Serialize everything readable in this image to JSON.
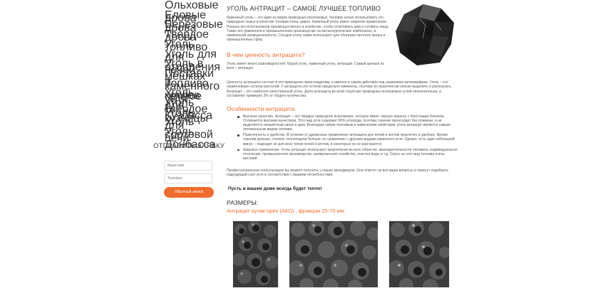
{
  "sidebar": {
    "items": [
      {
        "label": "Ольховые дрова"
      },
      {
        "label": "Еловые дрова"
      },
      {
        "label": "Березовые дрова"
      },
      {
        "label": "Твердое топливо"
      },
      {
        "label": "Уголь для печей и котлов"
      },
      {
        "label": "Уголь для отопления"
      },
      {
        "label": "Уголь в мешках"
      },
      {
        "label": "Поставки каменного угля"
      },
      {
        "label": "Топливо печное твердое"
      },
      {
        "label": "Уголь для кузницы"
      },
      {
        "label": "Уголь Кузбасса"
      },
      {
        "label": "Уголь для печи"
      },
      {
        "label": "Уголь сортовой"
      },
      {
        "label": "Уголь Донбасса"
      }
    ]
  },
  "form": {
    "title_part1": "Отправить",
    "title_part2": "заявку",
    "name_placeholder": "Ваше имя",
    "phone_placeholder": "Телефон",
    "submit_label": "Обратный звонок"
  },
  "article": {
    "title": "Уголь антрацит – самое лучшее топливо",
    "intro": "Каменный уголь – это один из видов природных ископаемых. Человек начал использовать это природное сырье в качестве топлива очень давно. Каменный уголь имеет широкое применение. Раньше его использовали преимущественно в хозяйстве, чтобы отапливать дом и готовить пищу. Также его применяли в промышленном производстве на металлургических комбинатах, в химической промышленности. Сегодня уголь также используют для обогрева частного жилья и промышленных сфер.",
    "section1_title": "В чем ценность антрацита?",
    "section1_p1": "Уголь имеет много разновидностей: бурый уголь, каменный уголь, антрацит. Самый ценный из всех – антрацит.",
    "section1_p2": "Ценность антрацита состоит в его природном происхождении, а именно в самом действии под названием метаморфизм. Уголь – это окаменевшие остатки растений. У антрацита эти остатки предельно изменены, поэтому их практически нельзя выделить и распознать. Антрацит – это наиболее качественный уголь. Доля антрацита во всей структуре природных ископаемых углей незначительна, и составляет примерно 3% от общего количества.",
    "section2_title": "Особенности антрацита",
    "features": [
      "Высокое качество. Антрацит – это твердое природное ископаемое, которое имеет черную окраску с блестящим блеском. Отличается высоким качеством. Этот вид угля содержит 95% углерода, поэтому горение происходит без пламени, и не выделяется неприятный запах и дым. Благодаря своим тепловым и химическим свойствам, уголь антрацит является самым оптимальным видом топлива.",
      "Практичность и удобство. В отличие от древесины применение антрацита для печей и котлов практично и удобнее. Время горения дольше, степень теплоотдачи больше, по сравнению с другими видами каменного угля. Однако, есть один небольшой минус – подходит не для всех типов печей и котлов, в некоторых он не разгорается.",
      "Широкое применение. Уголь антрацит используют практически во всех областях: жизнедеятельности человека: индивидуальное отопление, промышленное производство, коммунальное хозяйство, очистка воды и т.д. Спрос на этот вид топлива очень высокий."
    ],
    "consult": "Профессиональную консультацию вы можете получить у наших менеджеров. Они ответят на все ваши вопросы и помогут подобрать подходящий сорт угля в соответствии с вашими потребностями.",
    "slogan": "Пусть в вашем доме всегда будет тепло!",
    "sizes_title": "Размеры:",
    "sizes_subtitle": "Антрацит кулак-орех (АКО) , фракции 25-70 мм"
  },
  "colors": {
    "accent": "#ef6c2c",
    "link": "#3fa24a"
  }
}
